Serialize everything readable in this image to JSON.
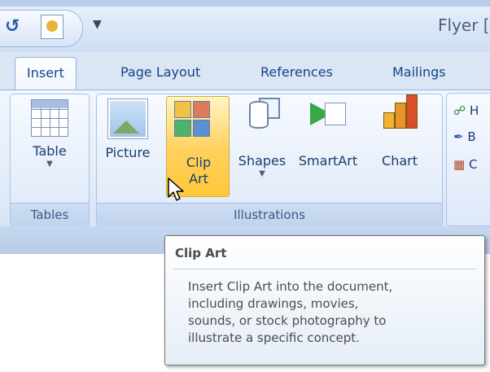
{
  "window": {
    "title": "Flyer [",
    "qat_undo_icon": "undo-icon",
    "qat_customize_symbol": "▼"
  },
  "tabs": [
    {
      "label": "Insert",
      "active": true
    },
    {
      "label": "Page Layout"
    },
    {
      "label": "References"
    },
    {
      "label": "Mailings"
    }
  ],
  "ribbon": {
    "groups": [
      {
        "label": "Tables",
        "buttons": [
          {
            "label": "Table",
            "icon": "table-icon",
            "has_dropdown": true
          }
        ]
      },
      {
        "label": "Illustrations",
        "buttons": [
          {
            "label": "Picture",
            "icon": "picture-icon"
          },
          {
            "label": "Clip Art",
            "label_line1": "Clip",
            "label_line2": "Art",
            "icon": "clip-art-icon",
            "highlighted": true
          },
          {
            "label": "Shapes",
            "icon": "shapes-icon",
            "has_dropdown": true
          },
          {
            "label": "SmartArt",
            "icon": "smartart-icon"
          },
          {
            "label": "Chart",
            "icon": "chart-icon"
          }
        ]
      }
    ],
    "partial_group_items": [
      "H",
      "B",
      "C"
    ]
  },
  "tooltip": {
    "title": "Clip Art",
    "body": "Insert Clip Art into the document, including drawings, movies, sounds, or stock photography to illustrate a specific concept.",
    "body_lines": [
      "Insert Clip Art into the document,",
      "including drawings, movies,",
      "sounds, or stock photography to",
      "illustrate a specific concept."
    ]
  },
  "colors": {
    "accent_text": "#15428b",
    "highlight": "#ffd15c",
    "ribbon_bg": "#e4edf9"
  }
}
